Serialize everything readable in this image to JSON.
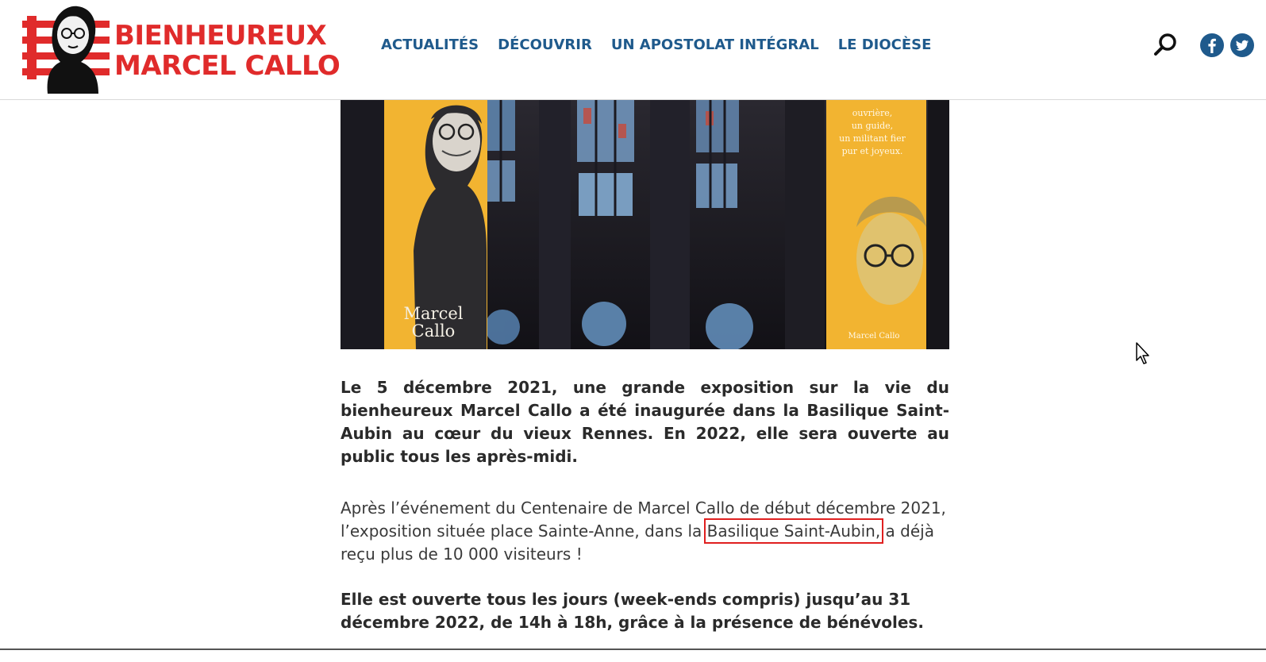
{
  "header": {
    "logo_line1": "BIENHEUREUX",
    "logo_line2": "MARCEL CALLO",
    "nav": [
      {
        "label": "ACTUALITÉS"
      },
      {
        "label": "DÉCOUVRIR"
      },
      {
        "label": "UN APOSTOLAT INTÉGRAL"
      },
      {
        "label": "LE DIOCÈSE"
      }
    ]
  },
  "hero": {
    "banner_left_text1": "Marcel",
    "banner_left_text2": "Callo",
    "banner_right_quote": [
      "ouvrière,",
      "un guide,",
      "un militant fier",
      "pur et joyeux."
    ],
    "banner_right_name": "Marcel Callo"
  },
  "article": {
    "lead": "Le 5 décembre 2021, une grande exposition sur la vie du bienheureux Marcel Callo a été inaugurée dans la Basilique Saint-Aubin au cœur du vieux Rennes. En 2022, elle sera ouverte au public tous les après-midi.",
    "para_before_link": "Après l’événement du Centenaire de Marcel Callo de début décembre 2021, l’exposition située place Sainte-Anne, dans la ",
    "para_link": "Basilique Saint-Aubin,",
    "para_after_link": " a déjà reçu plus de 10 000 visiteurs !",
    "closing": "Elle est ouverte tous les jours (week-ends compris) jusqu’au 31 décembre 2022, de 14h à 18h, grâce à la présence de bénévoles."
  },
  "colors": {
    "brand_red": "#e02b2b",
    "nav_blue": "#1f5a8c",
    "banner_yellow": "#f2b431"
  },
  "icons": {
    "search": "search-icon",
    "facebook": "facebook-icon",
    "twitter": "twitter-icon"
  }
}
